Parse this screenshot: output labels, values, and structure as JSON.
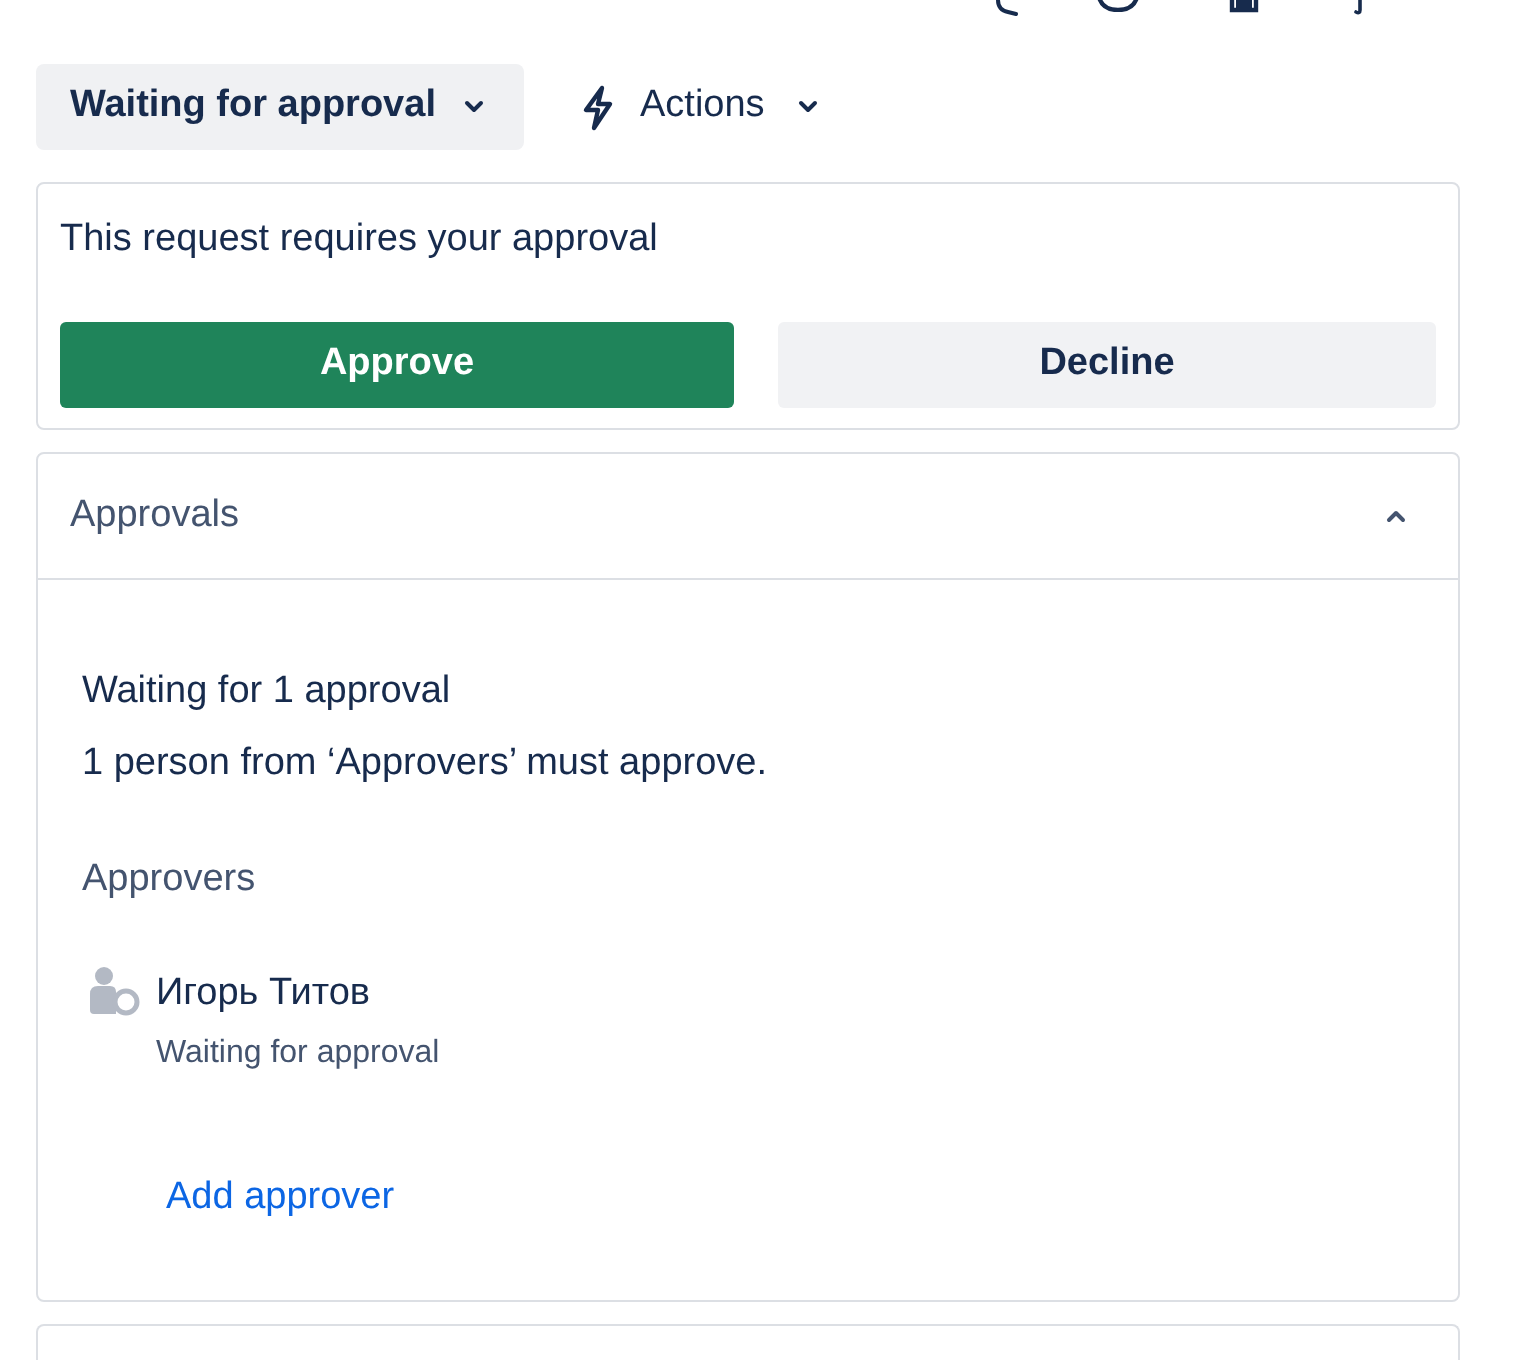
{
  "status_button": {
    "label": "Waiting for approval"
  },
  "actions_button": {
    "label": "Actions"
  },
  "approval_request": {
    "message": "This request requires your approval",
    "buttons": [
      {
        "label": "Approve",
        "kind": "primary"
      },
      {
        "label": "Decline",
        "kind": "secondary"
      }
    ]
  },
  "approvals_panel": {
    "title": "Approvals",
    "expanded": true,
    "summary_title": "Waiting for 1 approval",
    "summary_text": "1 person from ‘Approvers’ must approve.",
    "approvers_heading": "Approvers",
    "approvers": [
      {
        "name": "Игорь Титов",
        "status": "Waiting for approval"
      }
    ],
    "add_link": "Add approver"
  }
}
